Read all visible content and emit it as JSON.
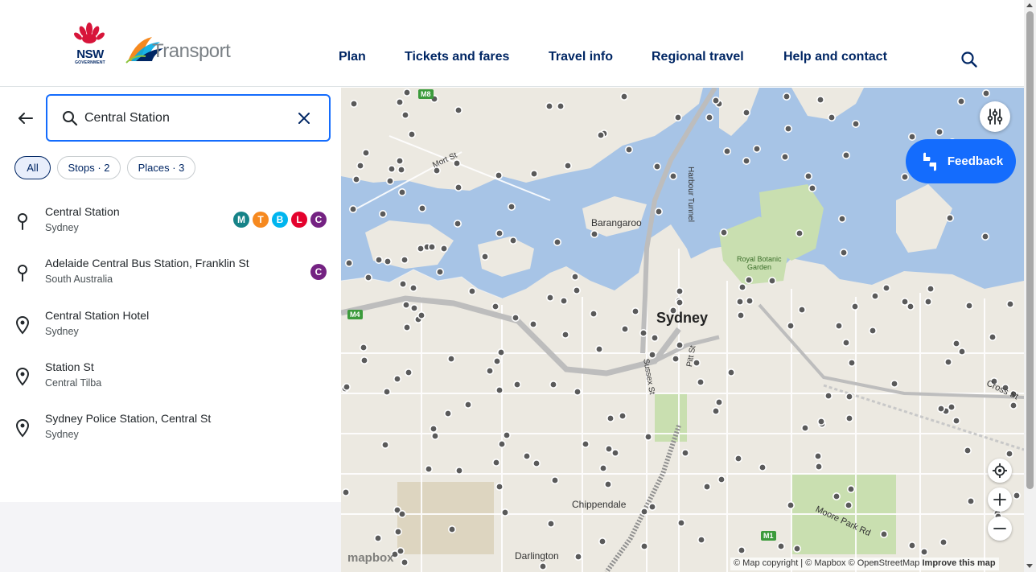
{
  "header": {
    "nsw_logo_text": "NSW",
    "nsw_logo_sub": "GOVERNMENT",
    "transport_logo_text": "Transport",
    "nav": [
      {
        "label": "Plan"
      },
      {
        "label": "Tickets and fares"
      },
      {
        "label": "Travel info"
      },
      {
        "label": "Regional travel"
      },
      {
        "label": "Help and contact"
      }
    ],
    "search_icon": "search-icon"
  },
  "search": {
    "value": "Central Station",
    "clear_icon": "close-icon",
    "back_icon": "arrow-left-icon"
  },
  "filters": [
    {
      "label": "All",
      "active": true
    },
    {
      "label": "Stops · 2",
      "active": false
    },
    {
      "label": "Places · 3",
      "active": false
    }
  ],
  "results": [
    {
      "name": "Central Station",
      "sub": "Sydney",
      "icon": "stop-pin-icon",
      "modes": [
        {
          "letter": "M",
          "color": "#168388",
          "name": "metro"
        },
        {
          "letter": "T",
          "color": "#f6891f",
          "name": "train"
        },
        {
          "letter": "B",
          "color": "#00b5ef",
          "name": "bus"
        },
        {
          "letter": "L",
          "color": "#e4022d",
          "name": "light-rail"
        },
        {
          "letter": "C",
          "color": "#742282",
          "name": "coach"
        }
      ]
    },
    {
      "name": "Adelaide Central Bus Station, Franklin St",
      "sub": "South Australia",
      "icon": "stop-pin-icon",
      "modes": [
        {
          "letter": "C",
          "color": "#742282",
          "name": "coach"
        }
      ]
    },
    {
      "name": "Central Station Hotel",
      "sub": "Sydney",
      "icon": "place-pin-icon",
      "modes": []
    },
    {
      "name": "Station St",
      "sub": "Central Tilba",
      "icon": "place-pin-icon",
      "modes": []
    },
    {
      "name": "Sydney Police Station, Central St",
      "sub": "Sydney",
      "icon": "place-pin-icon",
      "modes": []
    }
  ],
  "map": {
    "labels": {
      "sydney": "Sydney",
      "barangaroo": "Barangaroo",
      "chippendale": "Chippendale",
      "darlington": "Darlington",
      "royal_botanic_1": "Royal Botanic",
      "royal_botanic_2": "Garden",
      "harbour_tunnel": "Harbour Tunnel",
      "mort_st": "Mort St",
      "sussex_st": "Sussex St",
      "pitt_st": "Pitt St",
      "cross_st": "Cross St",
      "moore_park_rd": "Moore Park Rd"
    },
    "shields": {
      "m8": "M8",
      "m4": "M4",
      "m1": "M1"
    },
    "feedback_label": "Feedback",
    "attribution": {
      "copyright": "© Map copyright",
      "mapbox": "© Mapbox",
      "osm": "© OpenStreetMap",
      "improve": "Improve this map"
    },
    "mapbox_logo": "mapbox",
    "colors": {
      "water": "#a7c4e6",
      "land": "#ece9e1",
      "park": "#c9dfb0",
      "stop": "#5a5a5a"
    }
  }
}
